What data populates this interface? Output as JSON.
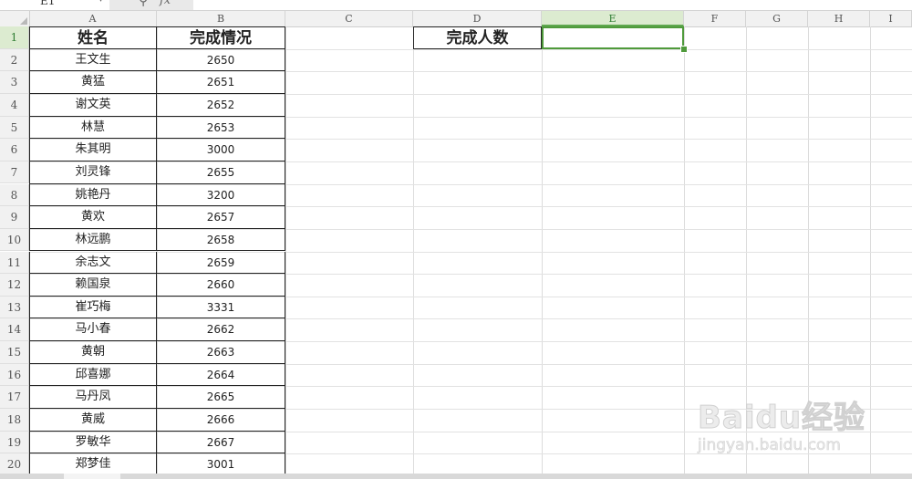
{
  "formula_bar": {
    "cell_reference": "E1",
    "fx_label": "fx"
  },
  "columns": [
    "A",
    "B",
    "C",
    "D",
    "E",
    "F",
    "G",
    "H",
    "I"
  ],
  "active_column": "E",
  "active_row": "1",
  "rows": [
    "1",
    "2",
    "3",
    "4",
    "5",
    "6",
    "7",
    "8",
    "9",
    "10",
    "11",
    "12",
    "13",
    "14",
    "15",
    "16",
    "17",
    "18",
    "19",
    "20"
  ],
  "sheet": {
    "header": {
      "name": "姓名",
      "completion": "完成情况"
    },
    "d1_label": "完成人数",
    "e1_value": "",
    "records": [
      {
        "name": "王文生",
        "value": "2650"
      },
      {
        "name": "黄猛",
        "value": "2651"
      },
      {
        "name": "谢文英",
        "value": "2652"
      },
      {
        "name": "林慧",
        "value": "2653"
      },
      {
        "name": "朱其明",
        "value": "3000"
      },
      {
        "name": "刘灵锋",
        "value": "2655"
      },
      {
        "name": "姚艳丹",
        "value": "3200"
      },
      {
        "name": "黄欢",
        "value": "2657"
      },
      {
        "name": "林远鹏",
        "value": "2658"
      },
      {
        "name": "余志文",
        "value": "2659"
      },
      {
        "name": "赖国泉",
        "value": "2660"
      },
      {
        "name": "崔巧梅",
        "value": "3331"
      },
      {
        "name": "马小春",
        "value": "2662"
      },
      {
        "name": "黄朝",
        "value": "2663"
      },
      {
        "name": "邱喜娜",
        "value": "2664"
      },
      {
        "name": "马丹凤",
        "value": "2665"
      },
      {
        "name": "黄威",
        "value": "2666"
      },
      {
        "name": "罗敏华",
        "value": "2667"
      },
      {
        "name": "郑梦佳",
        "value": "3001"
      }
    ]
  },
  "watermark": {
    "logo_text": "Baidu经验",
    "url_text": "jingyan.baidu.com"
  },
  "colors": {
    "selection": "#4f9a3b",
    "header_bg": "#f1f1f1",
    "active_header_bg": "#dcebd0"
  }
}
